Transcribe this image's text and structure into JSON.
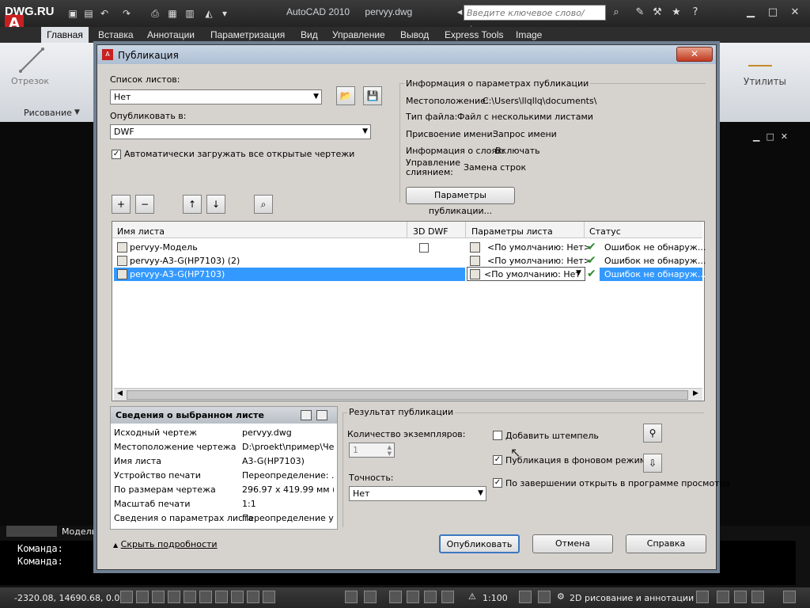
{
  "app": {
    "logo": "DWG.RU",
    "title": "AutoCAD 2010",
    "filename": "pervyy.dwg",
    "search_placeholder": "Введите ключевое слово/фразу"
  },
  "ribbon": {
    "tabs": [
      "Главная",
      "Вставка",
      "Аннотации",
      "Параметризация",
      "Вид",
      "Управление",
      "Вывод",
      "Express Tools",
      "Image"
    ],
    "active_tab": "Главная",
    "draw_tool": "Отрезок",
    "draw_panel": "Рисование",
    "utilities": "Утилиты"
  },
  "canvas": {
    "model_tab": "Модель",
    "command_lines": [
      "Команда:",
      "Команда:"
    ]
  },
  "status": {
    "coords": "-2320.08, 14690.68, 0.00",
    "scale": "1:100",
    "workspace": "2D рисование и аннотации"
  },
  "dialog": {
    "title": "Публикация",
    "close": "✕",
    "sheet_list_label": "Список листов:",
    "sheet_list_value": "Нет",
    "publish_to_label": "Опубликовать в:",
    "publish_to_value": "DWF",
    "auto_load_label": "Автоматически загружать все открытые чертежи",
    "auto_load_checked": true,
    "info": {
      "group_label": "Информация о параметрах публикации",
      "location_label": "Местоположение:",
      "location_value": "C:\\Users\\llqllq\\documents\\",
      "filetype_label": "Тип файла:",
      "filetype_value": "Файл с несколькими листами",
      "naming_label": "Присвоение имени:",
      "naming_value": "Запрос имени",
      "layers_label": "Информация о слоях:",
      "layers_value": "Включать",
      "merge_label_1": "Управление",
      "merge_label_2": "слиянием:",
      "merge_value": "Замена строк",
      "params_button": "Параметры публикации..."
    },
    "columns": [
      "Имя листа",
      "3D DWF",
      "Параметры листа",
      "Статус"
    ],
    "sheets": [
      {
        "name": "pervyy-Модель",
        "params": "<По умолчанию: Нет>",
        "status": "Ошибок не обнаруж..."
      },
      {
        "name": "pervyy-A3-G(HP7103) (2)",
        "params": "<По умолчанию: Нет>",
        "status": "Ошибок не обнаруж..."
      },
      {
        "name": "pervyy-A3-G(HP7103)",
        "params": "<По умолчанию: Нет",
        "status": "Ошибок не обнаруж..."
      }
    ],
    "details": {
      "header": "Сведения о выбранном листе",
      "rows": [
        {
          "k": "Исходный чертеж",
          "v": "pervyy.dwg"
        },
        {
          "k": "Местоположение чертежа",
          "v": "D:\\proekt\\пример\\Че..."
        },
        {
          "k": "Имя листа",
          "v": "A3-G(HP7103)"
        },
        {
          "k": "Устройство печати",
          "v": "Переопределение: ..."
        },
        {
          "k": "По размерам чертежа",
          "v": "296.97 x 419.99 мм (..."
        },
        {
          "k": "Масштаб печати",
          "v": "1:1"
        },
        {
          "k": "Сведения о параметрах листа",
          "v": "Переопределение у..."
        }
      ]
    },
    "result": {
      "group_label": "Результат публикации",
      "copies_label": "Количество экземпляров:",
      "copies_value": "1",
      "precision_label": "Точность:",
      "precision_value": "Нет",
      "stamp_label": "Добавить штемпель",
      "stamp_checked": false,
      "background_label": "Публикация в фоновом режиме",
      "background_checked": true,
      "open_viewer_label": "По завершении открыть в программе просмотра",
      "open_viewer_checked": true
    },
    "hide_details": "Скрыть подробности",
    "publish_button": "Опубликовать",
    "cancel_button": "Отмена",
    "help_button": "Справка"
  }
}
